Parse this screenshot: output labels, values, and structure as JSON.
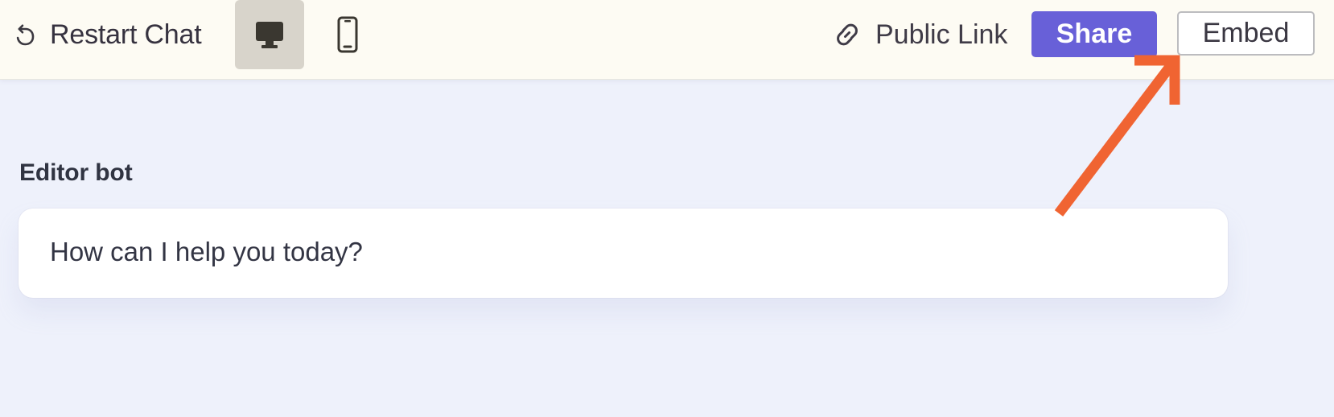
{
  "toolbar": {
    "restart_label": "Restart Chat",
    "public_link_label": "Public Link",
    "share_label": "Share",
    "embed_label": "Embed",
    "active_device": "desktop"
  },
  "icons": {
    "restart": "restart-icon",
    "desktop": "desktop-icon",
    "mobile": "mobile-icon",
    "link": "link-icon"
  },
  "chat": {
    "bot_name": "Editor bot",
    "messages": [
      {
        "text": "How can I help you today?"
      }
    ]
  },
  "annotation": {
    "type": "arrow",
    "color": "#f06432",
    "points_to": "embed-button"
  },
  "colors": {
    "topbar_background": "#fdfbf3",
    "page_background": "#eef1fb",
    "share_background": "#6860d8",
    "selected_device_background": "#d8d4cb"
  }
}
